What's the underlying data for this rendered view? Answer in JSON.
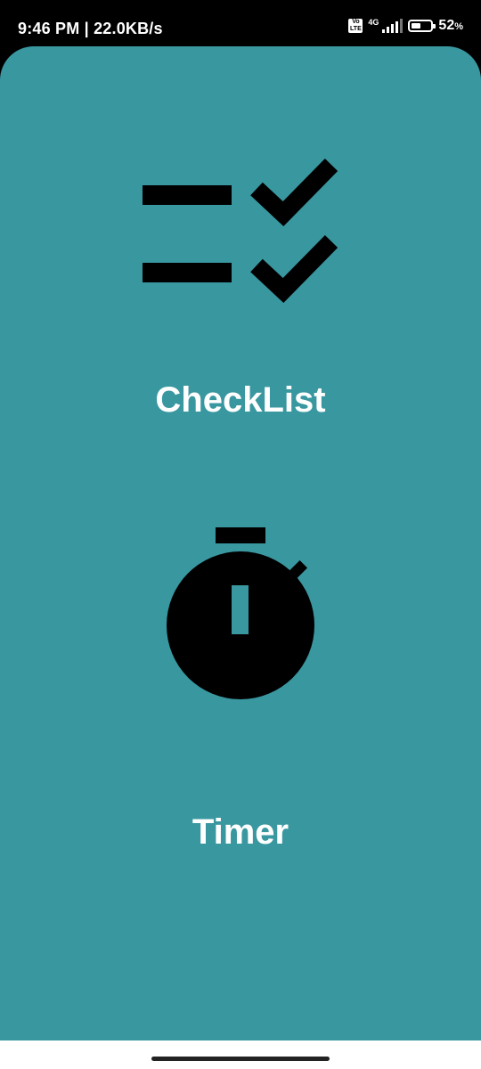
{
  "status_bar": {
    "time_speed": "9:46 PM | 22.0KB/s",
    "volte_badge": "Vo LTE",
    "network": "4G",
    "battery_level": 0.52,
    "battery_percent": "52",
    "battery_unit": "%"
  },
  "main": {
    "background_color": "#3997a0",
    "checklist": {
      "label": "CheckList",
      "icon": "checklist-icon"
    },
    "timer": {
      "label": "Timer",
      "icon": "stopwatch-icon"
    }
  }
}
